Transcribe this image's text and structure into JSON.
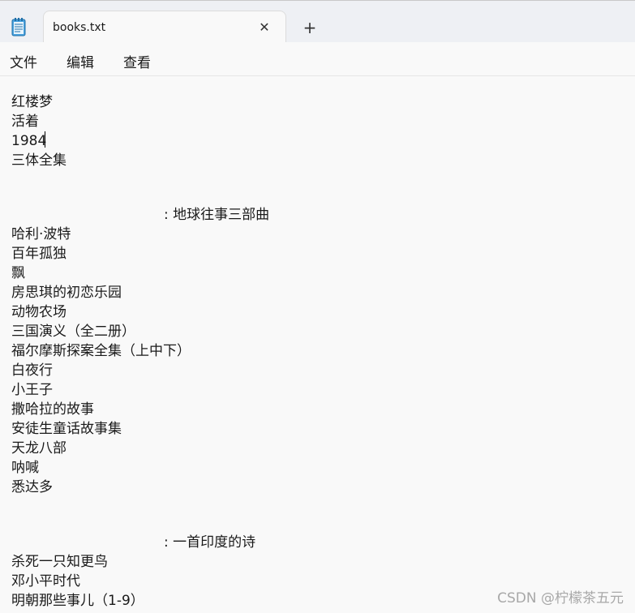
{
  "window": {
    "tab_title": "books.txt",
    "close_glyph": "✕",
    "new_tab_glyph": "+"
  },
  "menu": {
    "items": [
      "文件",
      "编辑",
      "查看"
    ]
  },
  "editor": {
    "lines": [
      "红楼梦",
      "活着",
      "1984",
      "三体全集",
      "",
      "",
      ": 地球往事三部曲",
      "哈利·波特",
      "百年孤独",
      "飘",
      "房思琪的初恋乐园",
      "动物农场",
      "三国演义（全二册）",
      "福尔摩斯探案全集（上中下）",
      "白夜行",
      "小王子",
      "撒哈拉的故事",
      "安徒生童话故事集",
      "天龙八部",
      "呐喊",
      "悉达多",
      "",
      "",
      ": 一首印度的诗",
      "杀死一只知更鸟",
      "邓小平时代",
      "明朝那些事儿（1-9）"
    ]
  },
  "watermark": "CSDN @柠檬茶五元",
  "colors": {
    "tabbar_bg": "#eef0f4",
    "editor_bg": "#f9f9f9",
    "text": "#1a1a1a",
    "watermark": "#a8a8a8"
  }
}
